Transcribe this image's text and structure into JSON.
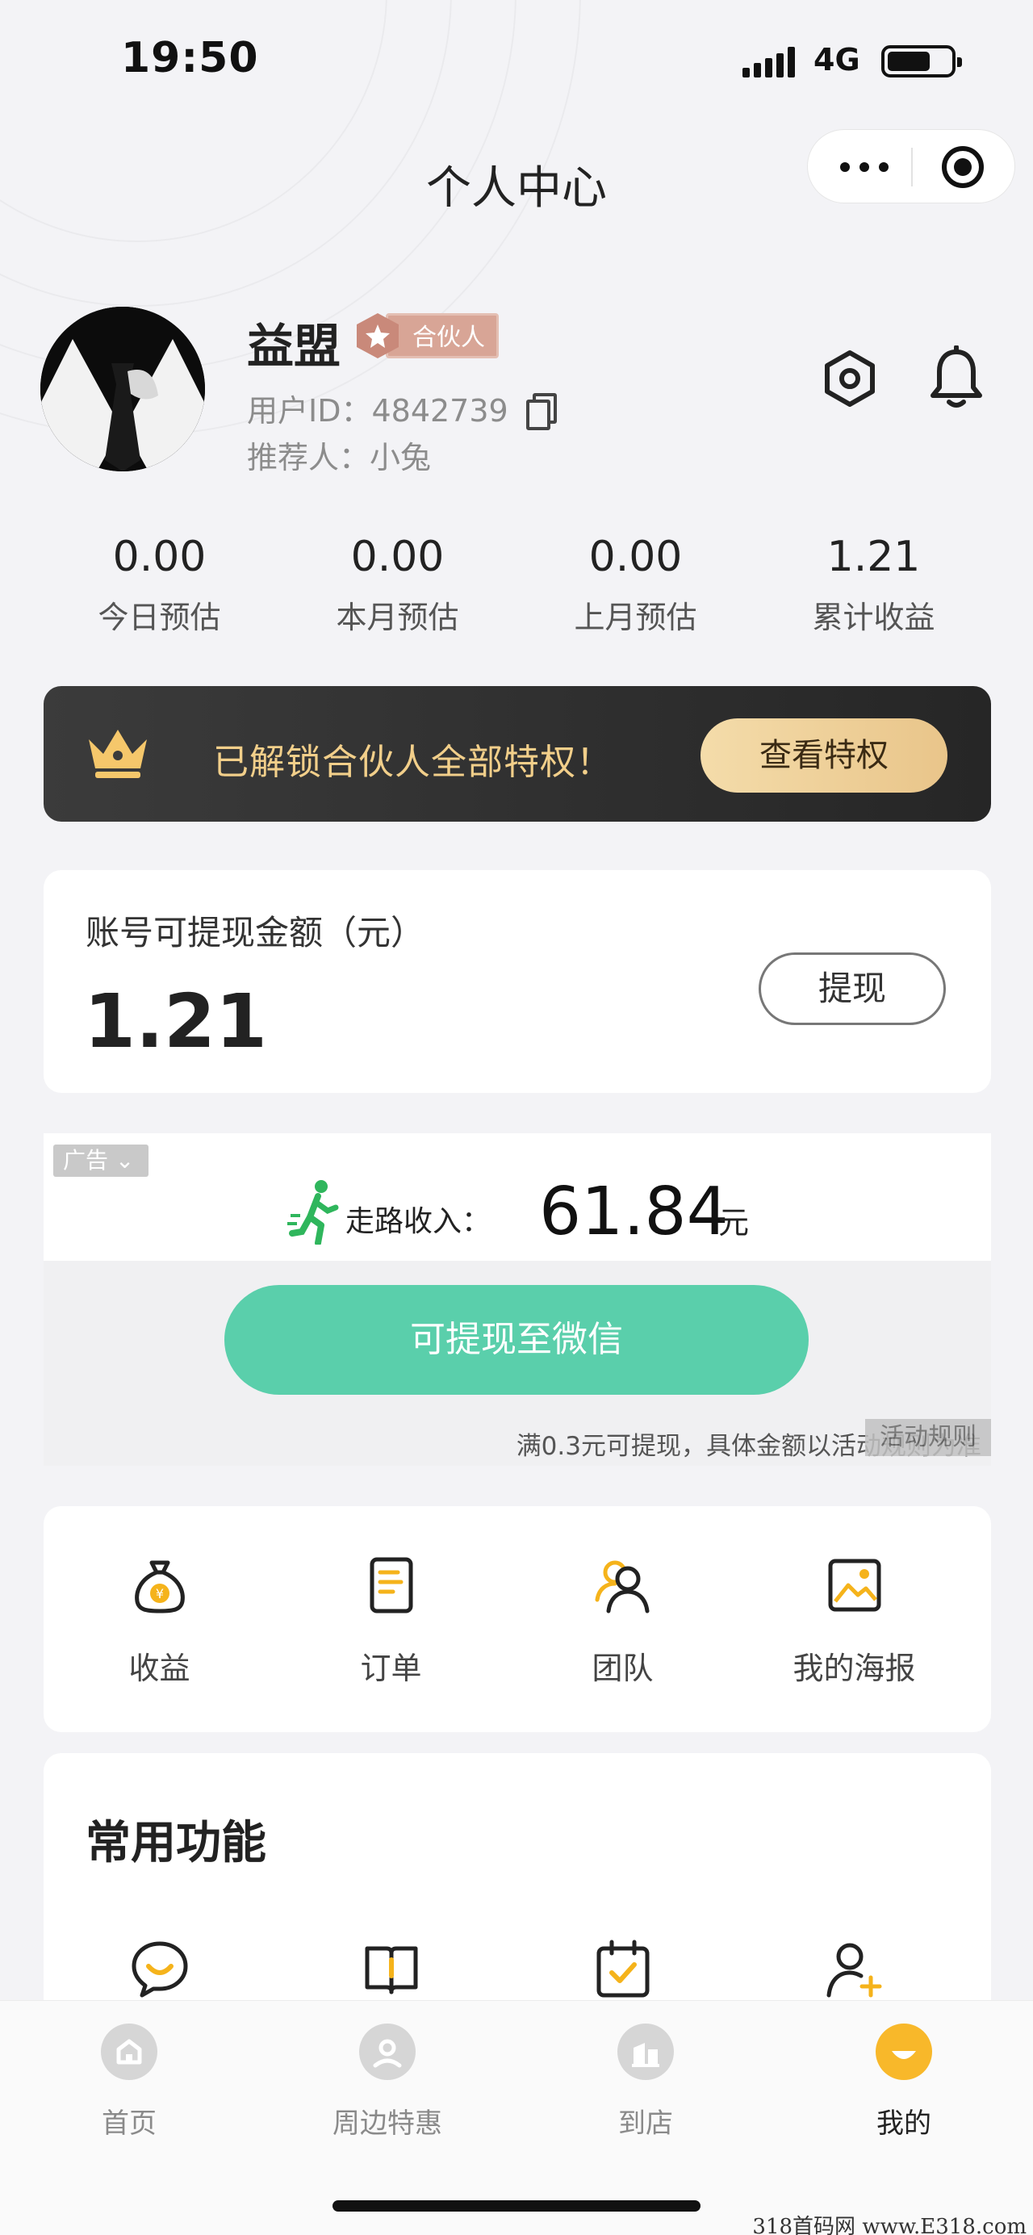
{
  "status_bar": {
    "time": "19:50",
    "network": "4G"
  },
  "page": {
    "title": "个人中心"
  },
  "profile": {
    "name": "益盟",
    "badge": "合伙人",
    "user_id": "用户ID：4842739",
    "referrer": "推荐人：小兔"
  },
  "stats": [
    {
      "value": "0.00",
      "label": "今日预估"
    },
    {
      "value": "0.00",
      "label": "本月预估"
    },
    {
      "value": "0.00",
      "label": "上月预估"
    },
    {
      "value": "1.21",
      "label": "累计收益"
    }
  ],
  "partner_banner": {
    "text": "已解锁合伙人全部特权！",
    "button": "查看特权",
    "accent": "#f2cf8a"
  },
  "withdraw": {
    "label": "账号可提现金额（元）",
    "amount": "1.21",
    "button": "提现"
  },
  "ad": {
    "tag": "广告",
    "walk_label": "走路收入：",
    "walk_amount": "61.84",
    "walk_unit": "元",
    "wechat_button": "可提现至微信",
    "note": "满0.3元可提现，具体金额以活动规则为准",
    "rule_tag": "活动规则",
    "button_color": "#5acfab"
  },
  "menu": [
    {
      "label": "收益",
      "icon": "money-bag-icon"
    },
    {
      "label": "订单",
      "icon": "order-icon"
    },
    {
      "label": "团队",
      "icon": "team-icon"
    },
    {
      "label": "我的海报",
      "icon": "poster-icon"
    }
  ],
  "common": {
    "title": "常用功能",
    "icons": [
      "chat-icon",
      "book-icon",
      "calendar-check-icon",
      "add-user-icon"
    ]
  },
  "tabs": [
    {
      "label": "首页",
      "icon": "home-icon"
    },
    {
      "label": "周边特惠",
      "icon": "location-icon"
    },
    {
      "label": "到店",
      "icon": "store-icon"
    },
    {
      "label": "我的",
      "icon": "profile-smile-icon",
      "active": true
    }
  ],
  "watermark": "318首码网 www.E318.com",
  "colors": {
    "brand_orange": "#f8b82a",
    "icon_accent": "#f5b31b"
  }
}
